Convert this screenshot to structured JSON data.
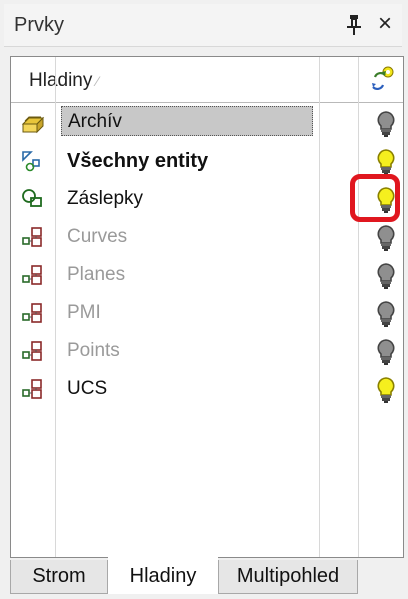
{
  "panel": {
    "title": "Prvky",
    "close_glyph": "×"
  },
  "grid": {
    "column_header": "Hladiny",
    "sort_glyph": "⁄",
    "visibility_header_icon": "layer-visibility-toggle-icon",
    "rows": [
      {
        "label": "Archív",
        "icon": "folder-stack-icon",
        "style": "selected",
        "bulb": "off"
      },
      {
        "label": "Všechny entity",
        "icon": "all-entities-layer-icon",
        "style": "bold",
        "bulb": "on"
      },
      {
        "label": "Záslepky",
        "icon": "caps-layer-icon",
        "style": "normal",
        "bulb": "on"
      },
      {
        "label": "Curves",
        "icon": "layer-group-icon",
        "style": "dim",
        "bulb": "off"
      },
      {
        "label": "Planes",
        "icon": "layer-group-icon",
        "style": "dim",
        "bulb": "off"
      },
      {
        "label": "PMI",
        "icon": "layer-group-icon",
        "style": "dim",
        "bulb": "off"
      },
      {
        "label": "Points",
        "icon": "layer-group-icon",
        "style": "dim",
        "bulb": "off"
      },
      {
        "label": "UCS",
        "icon": "layer-group-icon",
        "style": "normal",
        "bulb": "on"
      }
    ]
  },
  "tabs": [
    "Strom",
    "Hladiny",
    "Multipohled"
  ],
  "active_tab": "Hladiny",
  "colors": {
    "bulb_on": "#f5ef1e",
    "bulb_off": "#8f8f8f",
    "highlight": "#e0171f",
    "selected_row": "#c8c8c8"
  }
}
